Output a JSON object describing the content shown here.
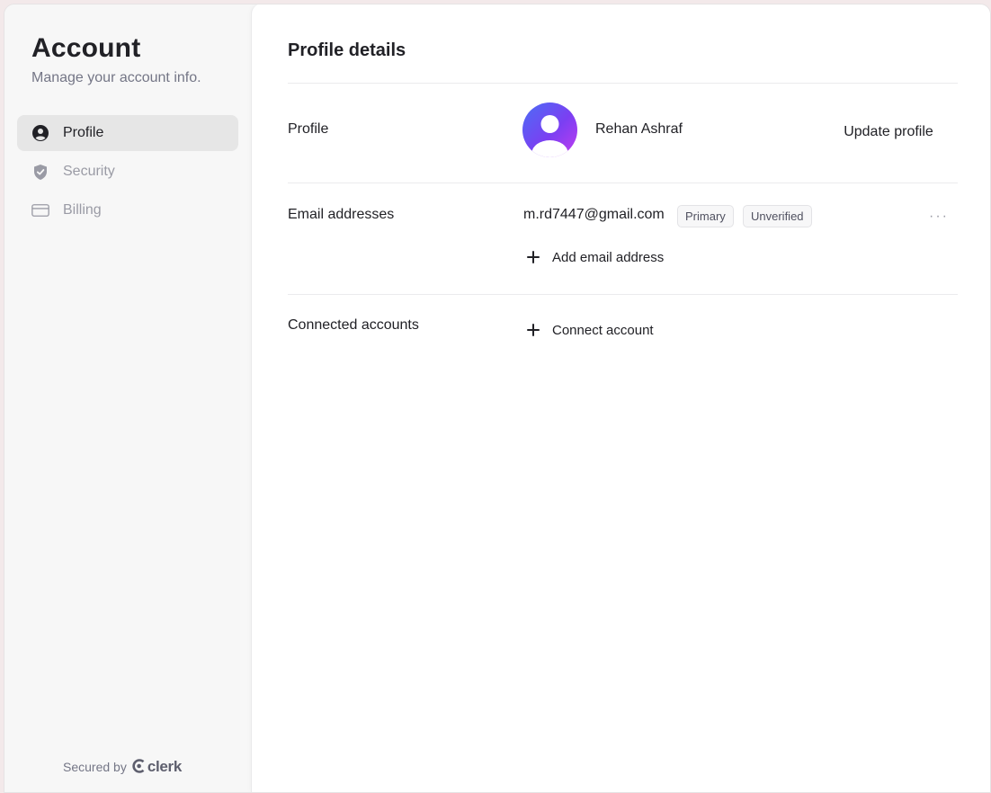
{
  "sidebar": {
    "title": "Account",
    "subtitle": "Manage your account info.",
    "items": [
      {
        "label": "Profile",
        "icon": "user-circle-icon",
        "active": true
      },
      {
        "label": "Security",
        "icon": "shield-icon",
        "active": false
      },
      {
        "label": "Billing",
        "icon": "credit-card-icon",
        "active": false
      }
    ],
    "secured_by": "Secured by",
    "brand": "clerk"
  },
  "main": {
    "title": "Profile details",
    "profile": {
      "label": "Profile",
      "name": "Rehan Ashraf",
      "update_label": "Update profile"
    },
    "emails": {
      "label": "Email addresses",
      "address": "m.rd7447@gmail.com",
      "badges": [
        "Primary",
        "Unverified"
      ],
      "menu": "···",
      "add_label": "Add email address"
    },
    "connected": {
      "label": "Connected accounts",
      "add_label": "Connect account"
    }
  },
  "colors": {
    "accent_gradient_start": "#4b6ef5",
    "accent_gradient_end": "#c23df0",
    "sidebar_bg": "#f7f7f7",
    "active_item_bg": "#e6e6e6"
  }
}
